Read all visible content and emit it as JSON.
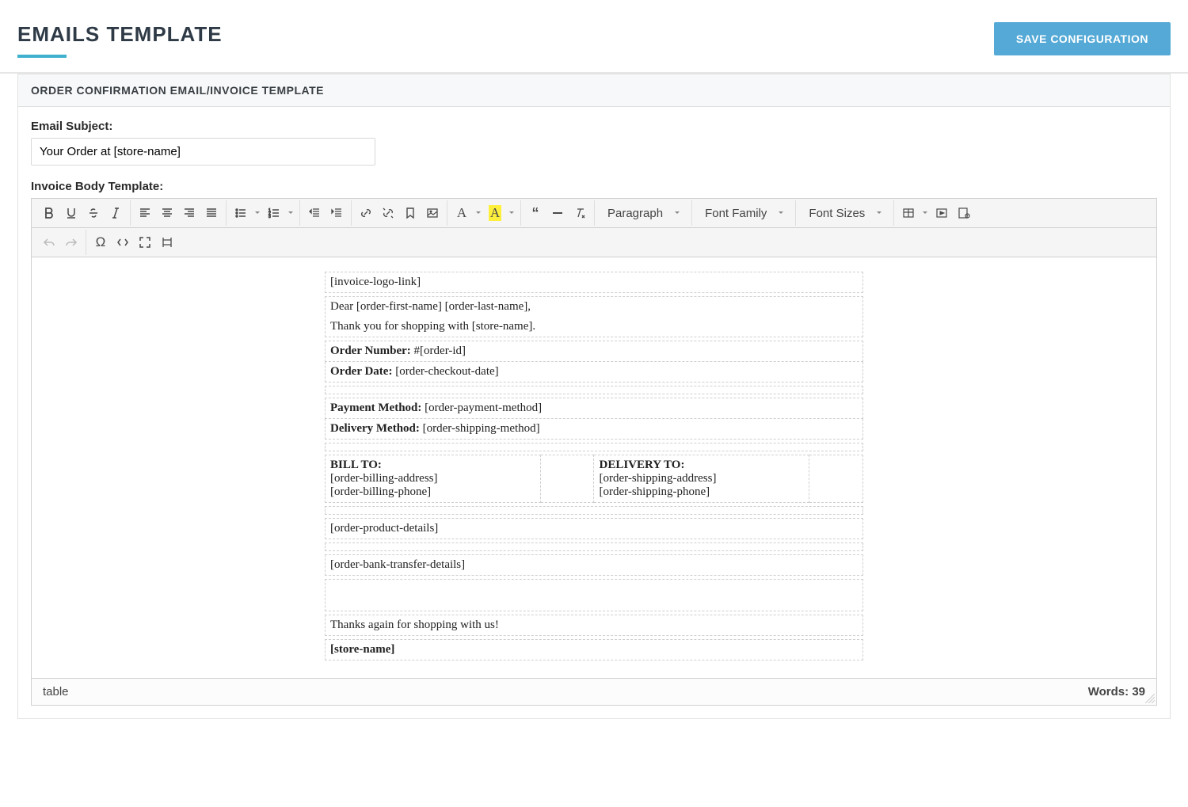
{
  "header": {
    "title": "EMAILS TEMPLATE",
    "save_label": "SAVE CONFIGURATION"
  },
  "panel": {
    "title": "ORDER CONFIRMATION EMAIL/INVOICE TEMPLATE"
  },
  "form": {
    "subject_label": "Email Subject:",
    "subject_value": "Your Order at [store-name]",
    "body_label": "Invoice Body Template:"
  },
  "editor": {
    "paragraph": "Paragraph",
    "font_family": "Font Family",
    "font_sizes": "Font Sizes",
    "text_color_letter": "A",
    "highlight_letter": "A"
  },
  "template": {
    "logo": "[invoice-logo-link]",
    "greeting": "Dear [order-first-name] [order-last-name],",
    "thanks1": "Thank you for shopping with [store-name].",
    "order_number_label": "Order Number:",
    "order_number_value": " #[order-id]",
    "order_date_label": "Order Date:",
    "order_date_value": " [order-checkout-date]",
    "payment_label": "Payment Method:",
    "payment_value": " [order-payment-method]",
    "delivery_label": "Delivery Method:",
    "delivery_value": " [order-shipping-method]",
    "billto_title": "BILL TO:",
    "billto_addr": "[order-billing-address]",
    "billto_phone": "[order-billing-phone]",
    "deliverto_title": "DELIVERY TO:",
    "deliverto_addr": "[order-shipping-address]",
    "deliverto_phone": "[order-shipping-phone]",
    "products": "[order-product-details]",
    "bank": "[order-bank-transfer-details]",
    "thanks2": "Thanks again for shopping with us!",
    "store": "[store-name]"
  },
  "status": {
    "path": "table",
    "words_label": "Words: ",
    "words_count": "39"
  }
}
